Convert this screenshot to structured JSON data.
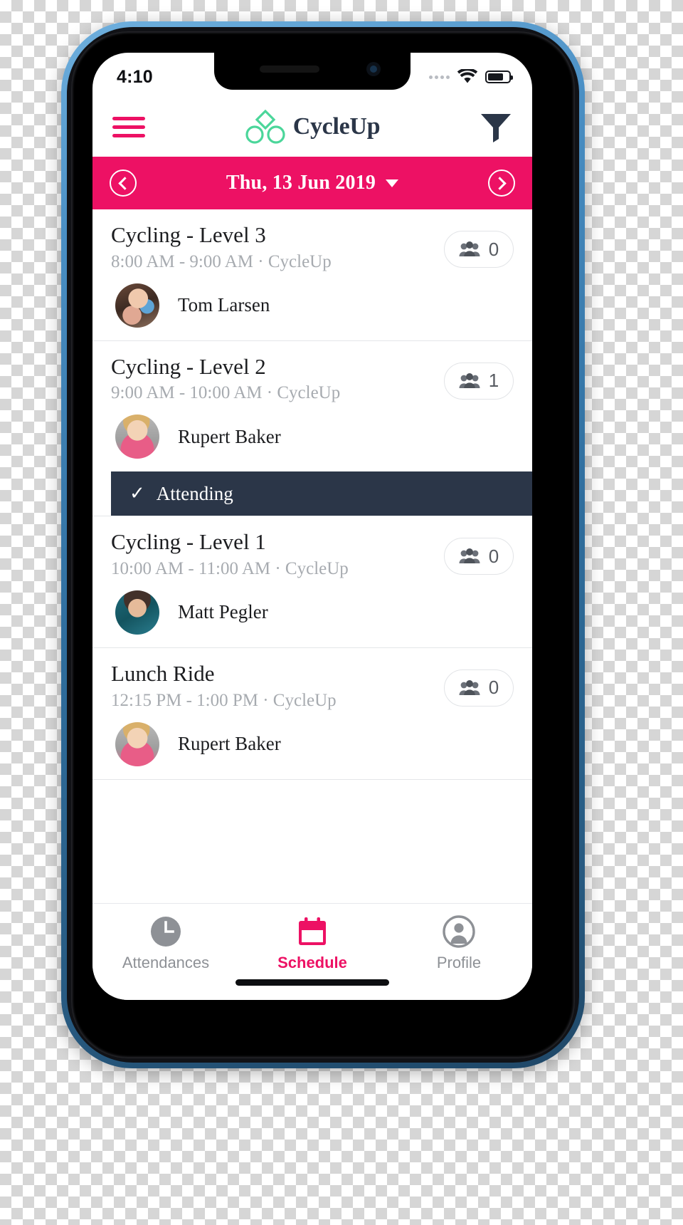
{
  "status_bar": {
    "time": "4:10",
    "signal_icon": "signal-dots-icon",
    "wifi_icon": "wifi-icon",
    "battery_icon": "battery-icon"
  },
  "app_header": {
    "menu_icon": "hamburger-menu-icon",
    "logo_icon": "cycleup-logo-icon",
    "brand": "CycleUp",
    "filter_icon": "filter-funnel-icon",
    "brand_color": "#2b3648",
    "accent_color": "#ed1164",
    "logo_color": "#4bd69a"
  },
  "date_bar": {
    "prev_icon": "chevron-left-circle-icon",
    "date": "Thu, 13 Jun 2019",
    "dropdown_icon": "caret-down-icon",
    "next_icon": "chevron-right-circle-icon",
    "background_color": "#ed1164"
  },
  "events": [
    {
      "title": "Cycling - Level 3",
      "subtitle": "8:00 AM - 9:00 AM · CycleUp",
      "attendee_count": "0",
      "count_icon": "people-group-icon",
      "instructor": "Tom Larsen",
      "avatar_icon": "avatar-tom-larsen",
      "attending": false
    },
    {
      "title": "Cycling - Level 2",
      "subtitle": "9:00 AM - 10:00 AM · CycleUp",
      "attendee_count": "1",
      "count_icon": "people-group-icon",
      "instructor": "Rupert Baker",
      "avatar_icon": "avatar-rupert-baker",
      "attending": true,
      "attending_label": "Attending",
      "attending_icon": "check-icon",
      "attending_color": "#2b3648"
    },
    {
      "title": "Cycling - Level 1",
      "subtitle": "10:00 AM - 11:00 AM · CycleUp",
      "attendee_count": "0",
      "count_icon": "people-group-icon",
      "instructor": "Matt Pegler",
      "avatar_icon": "avatar-matt-pegler",
      "attending": false
    },
    {
      "title": "Lunch Ride",
      "subtitle": "12:15 PM - 1:00 PM · CycleUp",
      "attendee_count": "0",
      "count_icon": "people-group-icon",
      "instructor": "Rupert Baker",
      "avatar_icon": "avatar-rupert-baker",
      "attending": false
    }
  ],
  "bottom_nav": {
    "items": [
      {
        "label": "Attendances",
        "icon": "clock-icon",
        "active": false
      },
      {
        "label": "Schedule",
        "icon": "calendar-icon",
        "active": true
      },
      {
        "label": "Profile",
        "icon": "person-icon",
        "active": false
      }
    ],
    "active_color": "#ed1164",
    "inactive_color": "#8e9196"
  }
}
